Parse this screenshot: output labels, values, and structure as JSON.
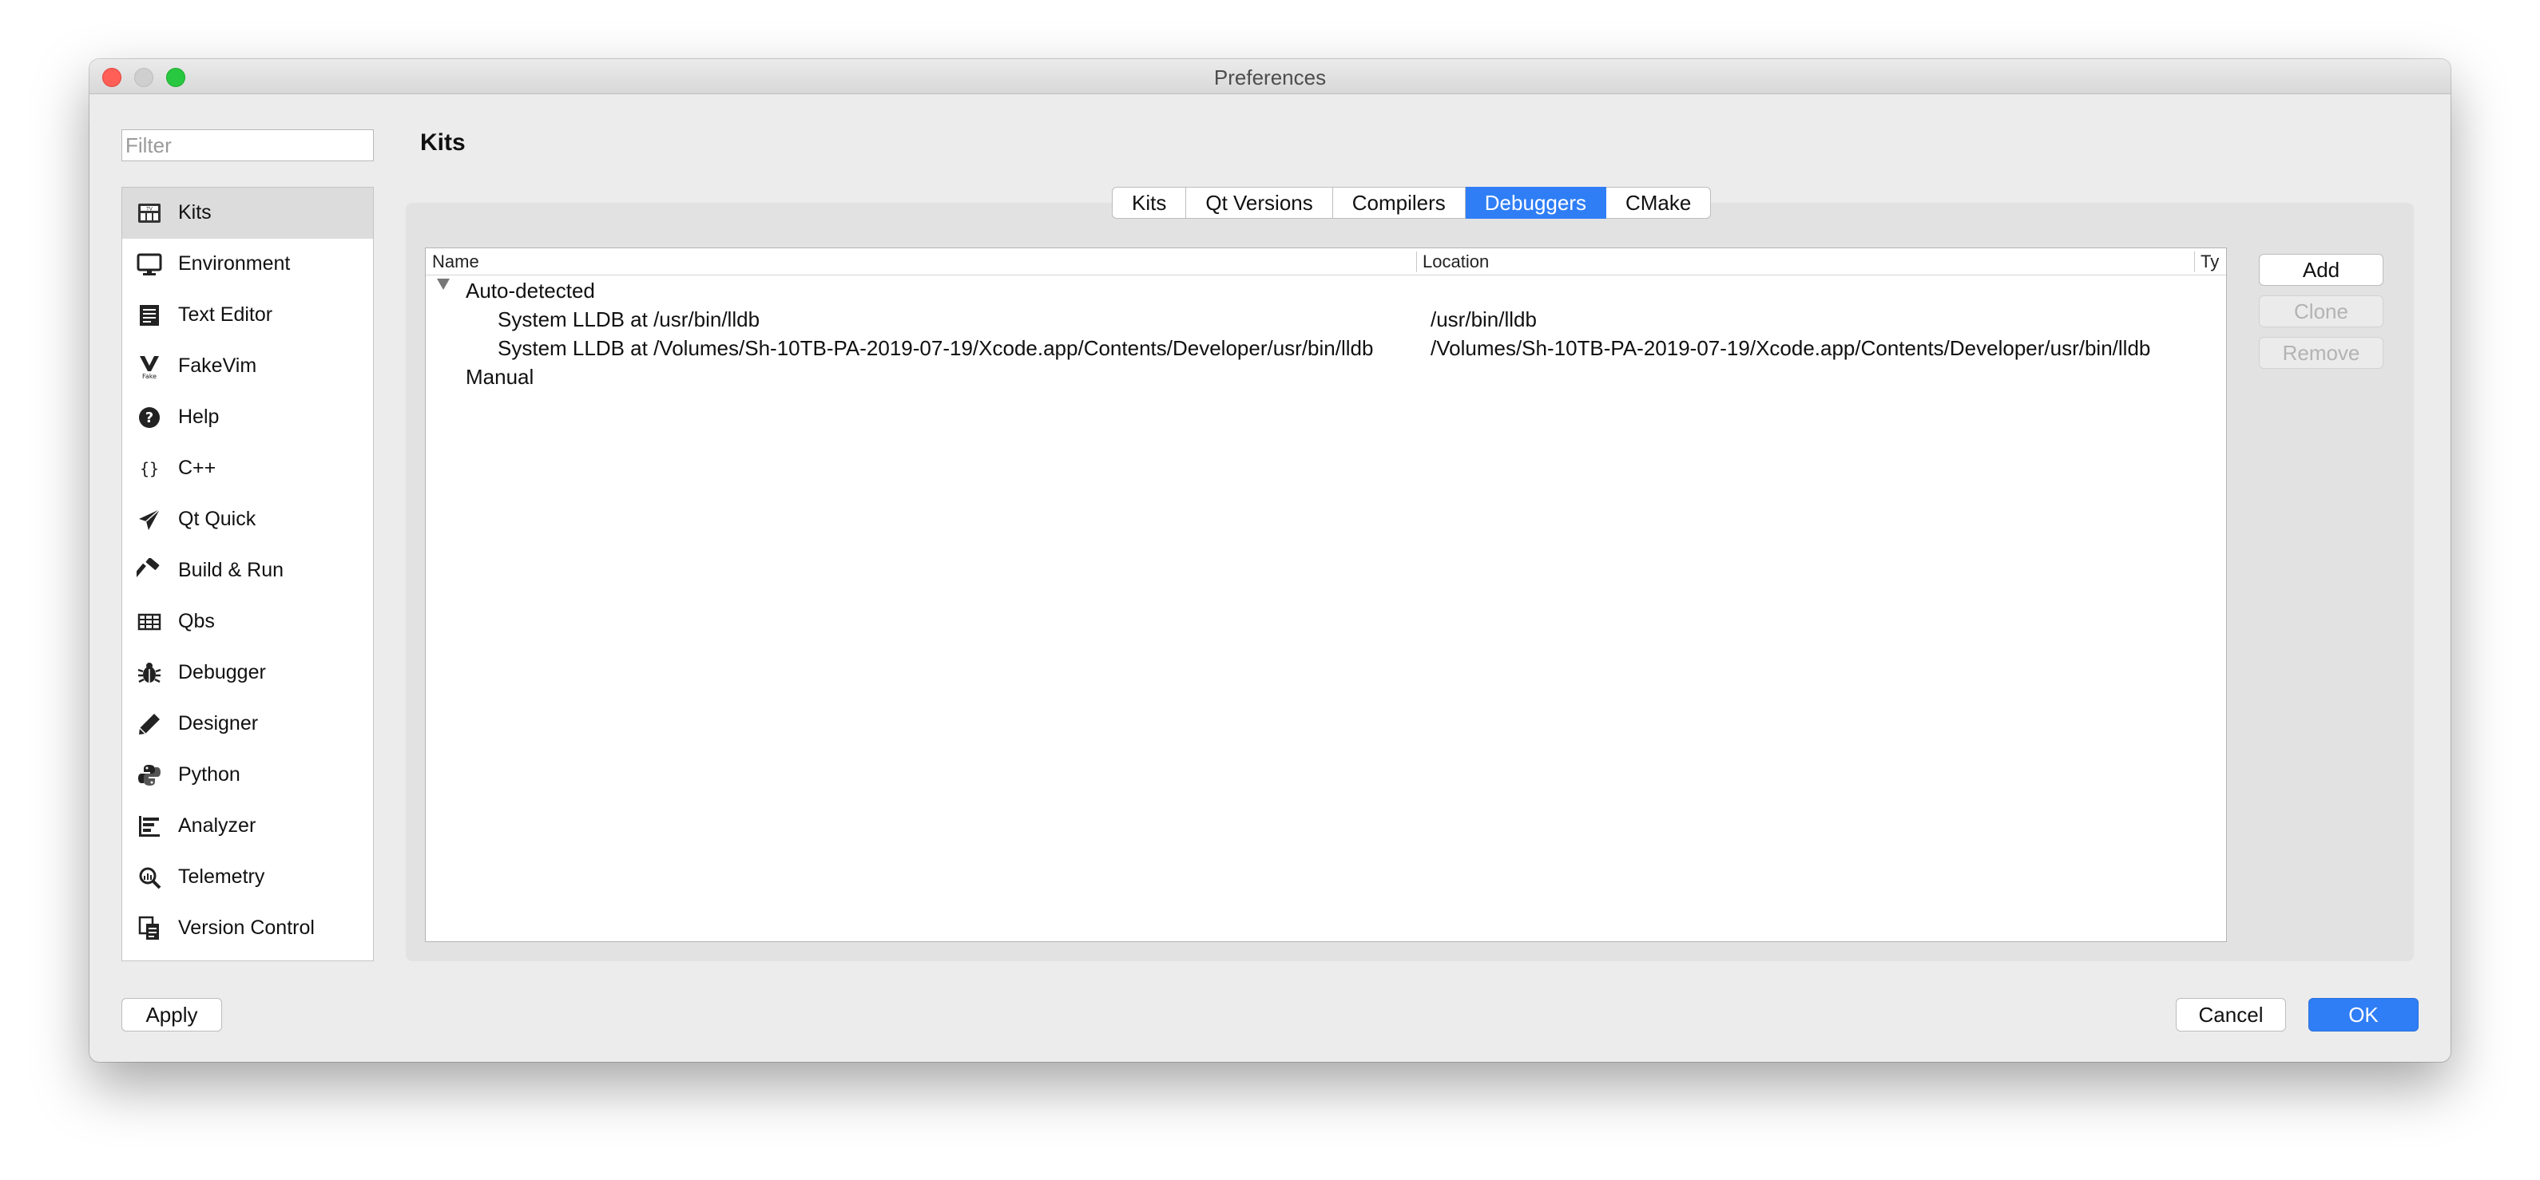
{
  "window": {
    "title": "Preferences"
  },
  "filter": {
    "placeholder": "Filter"
  },
  "sidebar": {
    "items": [
      {
        "label": "Kits",
        "icon": "kits-icon"
      },
      {
        "label": "Environment",
        "icon": "monitor-icon"
      },
      {
        "label": "Text Editor",
        "icon": "text-editor-icon"
      },
      {
        "label": "FakeVim",
        "icon": "fakevim-icon"
      },
      {
        "label": "Help",
        "icon": "help-icon"
      },
      {
        "label": "C++",
        "icon": "braces-icon"
      },
      {
        "label": "Qt Quick",
        "icon": "paper-plane-icon"
      },
      {
        "label": "Build & Run",
        "icon": "hammer-icon"
      },
      {
        "label": "Qbs",
        "icon": "qbs-icon"
      },
      {
        "label": "Debugger",
        "icon": "bug-icon"
      },
      {
        "label": "Designer",
        "icon": "pencil-icon"
      },
      {
        "label": "Python",
        "icon": "python-icon"
      },
      {
        "label": "Analyzer",
        "icon": "analyzer-icon"
      },
      {
        "label": "Telemetry",
        "icon": "telemetry-icon"
      },
      {
        "label": "Version Control",
        "icon": "version-control-icon"
      }
    ],
    "selected": "Kits"
  },
  "page": {
    "title": "Kits"
  },
  "tabs": [
    "Kits",
    "Qt Versions",
    "Compilers",
    "Debuggers",
    "CMake"
  ],
  "active_tab": "Debuggers",
  "table": {
    "columns": [
      "Name",
      "Location",
      "Ty"
    ],
    "groups": [
      {
        "label": "Auto-detected",
        "rows": [
          {
            "name": "System LLDB at /usr/bin/lldb",
            "location": "/usr/bin/lldb"
          },
          {
            "name": "System LLDB at /Volumes/Sh-10TB-PA-2019-07-19/Xcode.app/Contents/Developer/usr/bin/lldb",
            "location": "/Volumes/Sh-10TB-PA-2019-07-19/Xcode.app/Contents/Developer/usr/bin/lldb"
          }
        ]
      },
      {
        "label": "Manual",
        "rows": []
      }
    ]
  },
  "actions": {
    "add": "Add",
    "clone": "Clone",
    "remove": "Remove"
  },
  "footer": {
    "apply": "Apply",
    "cancel": "Cancel",
    "ok": "OK"
  },
  "colors": {
    "accent": "#2f7ef6",
    "close": "#ff5f57",
    "maximize": "#28c840"
  }
}
